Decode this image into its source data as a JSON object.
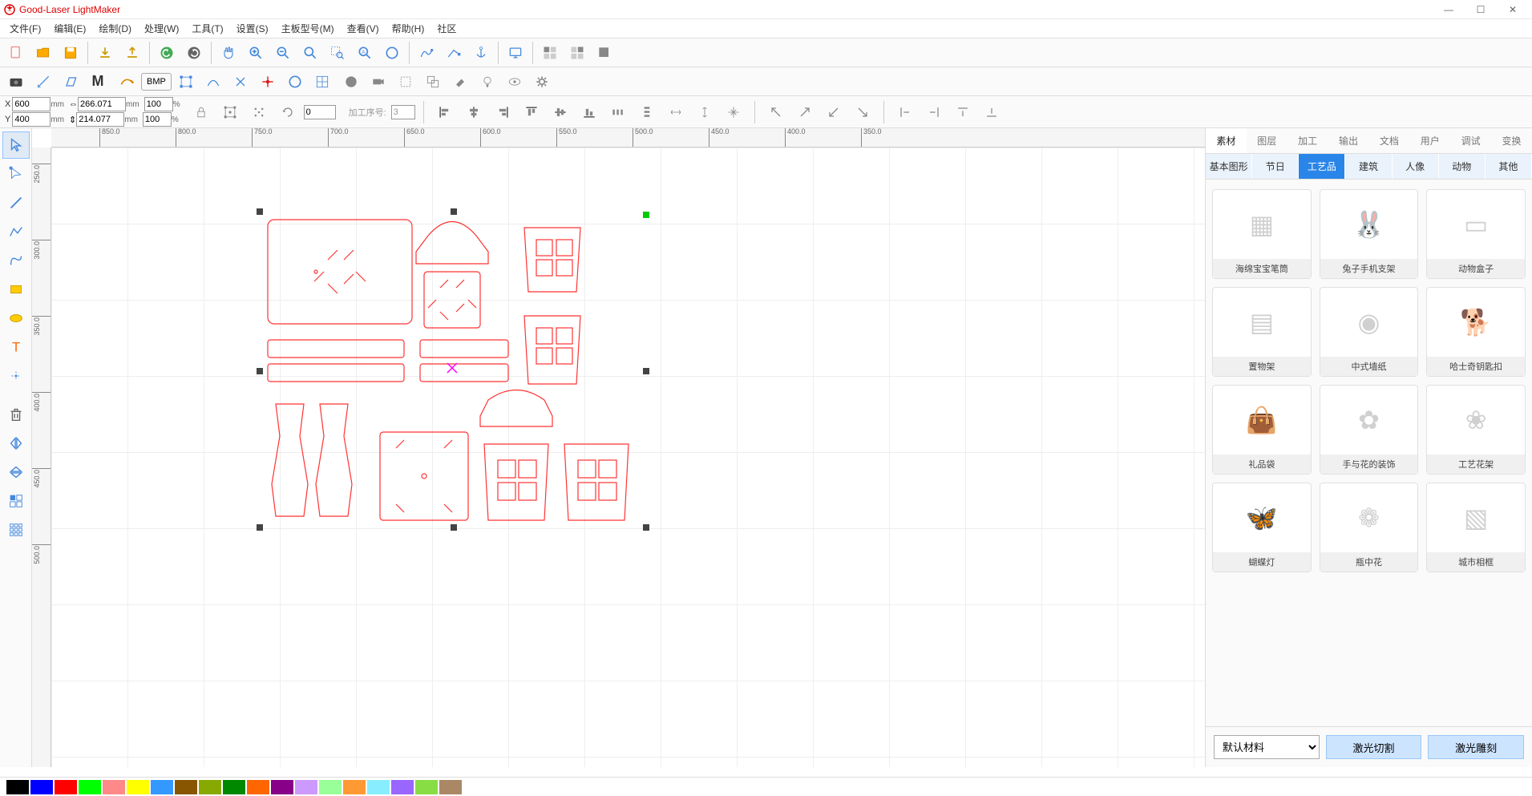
{
  "app": {
    "title": "Good-Laser LightMaker"
  },
  "menus": [
    "文件(F)",
    "编辑(E)",
    "绘制(D)",
    "处理(W)",
    "工具(T)",
    "设置(S)",
    "主板型号(M)",
    "查看(V)",
    "帮助(H)",
    "社区"
  ],
  "coords": {
    "x_label": "X",
    "x_val": "600",
    "x_unit": "mm",
    "y_label": "Y",
    "y_val": "400",
    "y_unit": "mm",
    "w_val": "266.071",
    "w_unit": "mm",
    "w_pct": "100",
    "pct_unit": "%",
    "h_val": "214.077",
    "h_unit": "mm",
    "h_pct": "100",
    "rot_val": "0",
    "proc_label": "加工序号:",
    "proc_val": "3"
  },
  "ruler_h": [
    "850.0",
    "800.0",
    "750.0",
    "700.0",
    "650.0",
    "600.0",
    "550.0",
    "500.0",
    "450.0",
    "400.0",
    "350.0"
  ],
  "ruler_v": [
    "250.0",
    "300.0",
    "350.0",
    "400.0",
    "450.0",
    "500.0"
  ],
  "rtabs1": [
    "素材",
    "图层",
    "加工",
    "输出",
    "文档",
    "用户",
    "调试",
    "变换"
  ],
  "rtabs1_sel": 0,
  "rtabs2": [
    "基本图形",
    "节日",
    "工艺品",
    "建筑",
    "人像",
    "动物",
    "其他"
  ],
  "rtabs2_sel": 2,
  "gallery": [
    "海绵宝宝笔筒",
    "兔子手机支架",
    "动物盒子",
    "置物架",
    "中式墙纸",
    "哈士奇钥匙扣",
    "礼品袋",
    "手与花的装饰",
    "工艺花架",
    "蝴蝶灯",
    "瓶中花",
    "城市相框"
  ],
  "material": {
    "default": "默认材料",
    "cut": "激光切割",
    "engrave": "激光雕刻"
  },
  "bmp_label": "BMP",
  "colors": [
    "#000",
    "#00f",
    "#f00",
    "#0f0",
    "#f88",
    "#ff0",
    "#39f",
    "#850",
    "#8a0",
    "#080",
    "#f60",
    "#808",
    "#c9f",
    "#9f9",
    "#f93",
    "#8ef",
    "#96f",
    "#8d4",
    "#a86"
  ]
}
